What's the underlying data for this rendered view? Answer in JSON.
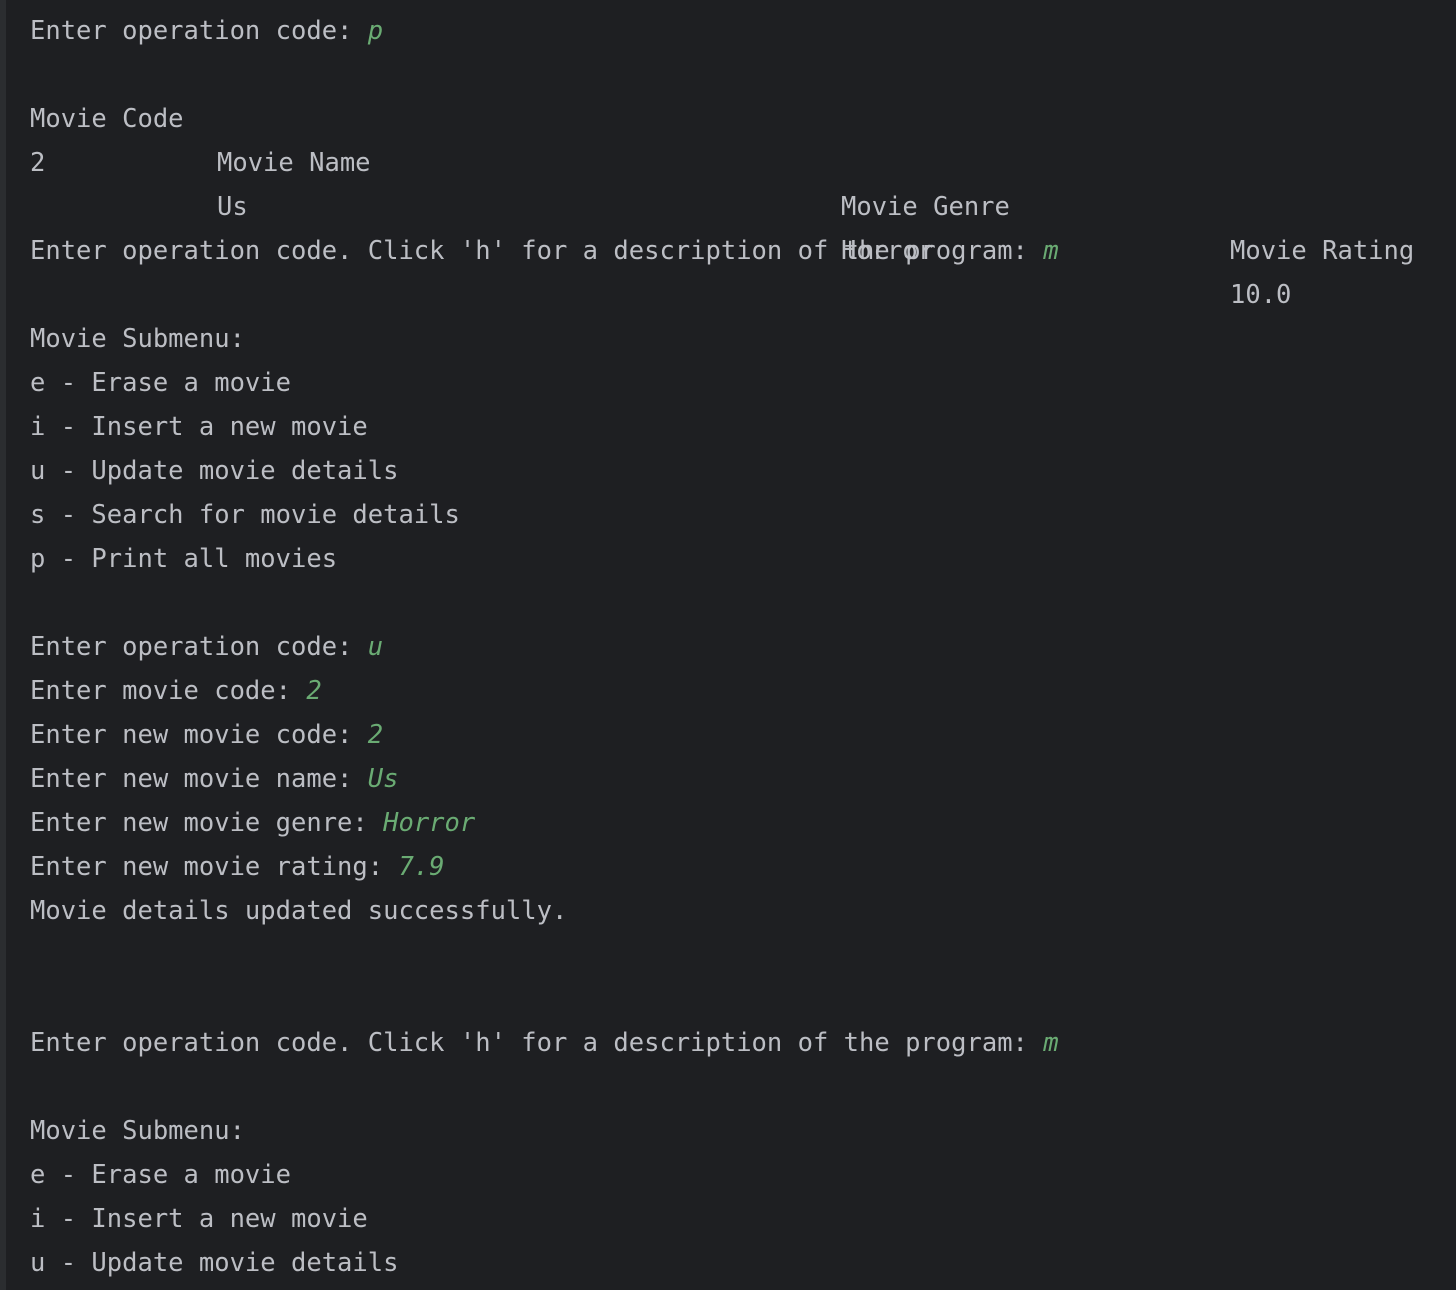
{
  "session": {
    "block1": {
      "prompt": "Enter operation code: ",
      "input": "p"
    },
    "table": {
      "headers": [
        "Movie Code",
        "Movie Name",
        "Movie Genre",
        "Movie Rating"
      ],
      "rows": [
        [
          "2",
          "Us",
          "Horror",
          "10.0"
        ]
      ]
    },
    "block2": {
      "prompt": "Enter operation code. Click 'h' for a description of the program: ",
      "input": "m",
      "submenu_title": "Movie Submenu:",
      "items": [
        "e - Erase a movie",
        "i - Insert a new movie",
        "u - Update movie details",
        "s - Search for movie details",
        "p - Print all movies"
      ]
    },
    "block3": {
      "lines": [
        {
          "prompt": "Enter operation code: ",
          "input": "u"
        },
        {
          "prompt": "Enter movie code: ",
          "input": "2"
        },
        {
          "prompt": "Enter new movie code: ",
          "input": "2"
        },
        {
          "prompt": "Enter new movie name: ",
          "input": "Us"
        },
        {
          "prompt": "Enter new movie genre: ",
          "input": "Horror"
        },
        {
          "prompt": "Enter new movie rating: ",
          "input": "7.9"
        }
      ],
      "result": "Movie details updated successfully."
    },
    "block4": {
      "prompt": "Enter operation code. Click 'h' for a description of the program: ",
      "input": "m",
      "submenu_title": "Movie Submenu:",
      "items": [
        "e - Erase a movie",
        "i - Insert a new movie",
        "u - Update movie details"
      ]
    }
  },
  "colors": {
    "background": "#1e1f22",
    "text": "#bcbec4",
    "user_input": "#6aab73"
  }
}
